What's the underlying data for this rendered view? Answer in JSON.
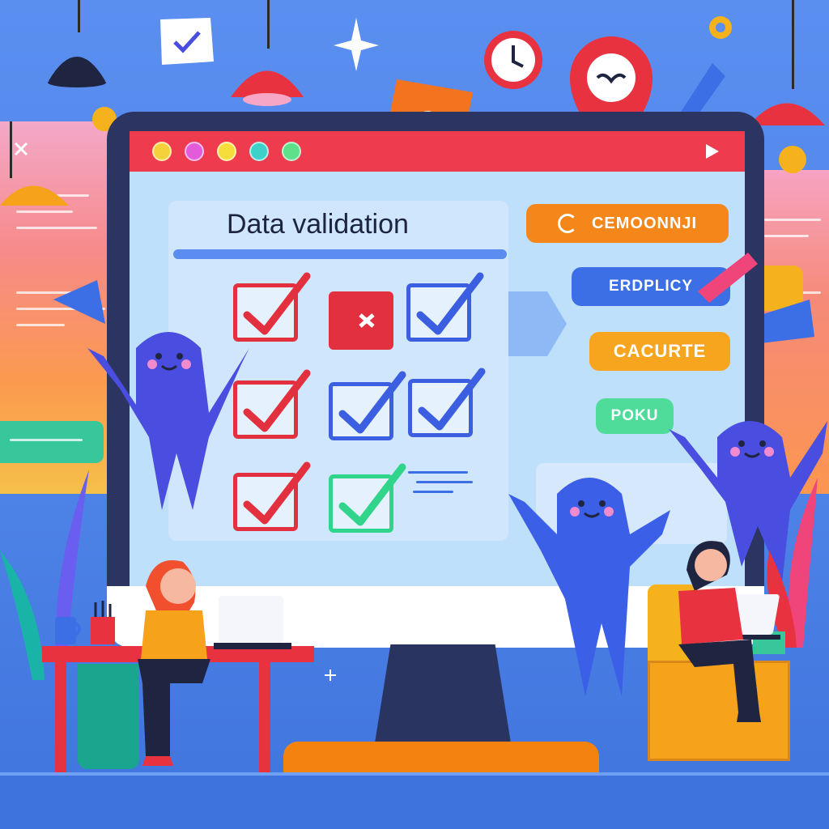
{
  "card": {
    "title": "Data validation"
  },
  "pills": [
    {
      "label": "CEMOONNJI",
      "color": "#f5861a"
    },
    {
      "label": "ERDPLICY",
      "color": "#3c6fe5"
    },
    {
      "label": "CACURTE",
      "color": "#f7a51f"
    },
    {
      "label": "POKU",
      "color": "#4fdb9a"
    }
  ],
  "titlebar_dots": [
    "#f5d23b",
    "#e25bd9",
    "#f6dd3a",
    "#3ed1c9",
    "#5ee08a"
  ],
  "checkboxes": [
    {
      "state": "checked",
      "color": "#e3303f"
    },
    {
      "state": "crossed",
      "color": "#e3303f"
    },
    {
      "state": "checked",
      "color": "#3b5fe0"
    },
    {
      "state": "checked",
      "color": "#e3303f"
    },
    {
      "state": "checked",
      "color": "#3b5fe0"
    },
    {
      "state": "checked",
      "color": "#3b5fe0"
    },
    {
      "state": "checked",
      "color": "#e3303f"
    },
    {
      "state": "checked",
      "color": "#30d48a"
    }
  ],
  "colors": {
    "screen_bg": "#bfe0fb",
    "titlebar": "#ee3b4d",
    "monitor_frame": "#2c3562",
    "mascot": "#4a4ee0",
    "accent_orange": "#f3820f"
  }
}
